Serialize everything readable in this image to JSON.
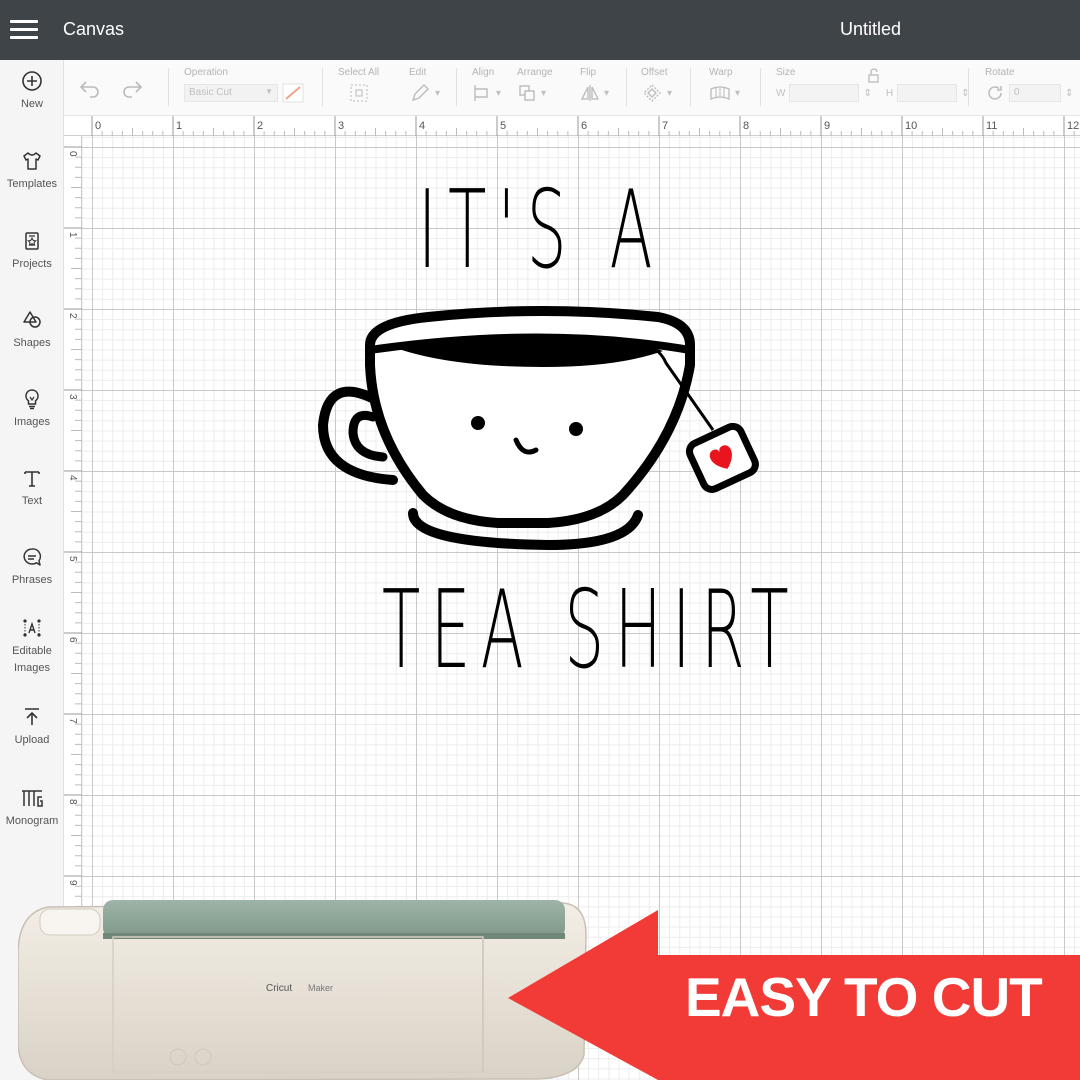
{
  "header": {
    "app_title": "Canvas",
    "doc_title": "Untitled"
  },
  "sidebar": {
    "items": [
      {
        "label": "New",
        "icon": "plus-circle-icon"
      },
      {
        "label": "Templates",
        "icon": "tshirt-icon"
      },
      {
        "label": "Projects",
        "icon": "projects-icon"
      },
      {
        "label": "Shapes",
        "icon": "shapes-icon"
      },
      {
        "label": "Images",
        "icon": "lightbulb-icon"
      },
      {
        "label": "Text",
        "icon": "text-icon"
      },
      {
        "label": "Phrases",
        "icon": "speech-bubble-icon"
      },
      {
        "label": "Editable Images",
        "icon": "editable-images-icon"
      },
      {
        "label": "Upload",
        "icon": "upload-icon"
      },
      {
        "label": "Monogram",
        "icon": "monogram-icon"
      }
    ]
  },
  "toolbar": {
    "operation_label": "Operation",
    "operation_value": "Basic Cut",
    "select_all_label": "Select All",
    "edit_label": "Edit",
    "align_label": "Align",
    "arrange_label": "Arrange",
    "flip_label": "Flip",
    "offset_label": "Offset",
    "warp_label": "Warp",
    "size_label": "Size",
    "size_w": "W",
    "size_h": "H",
    "rotate_label": "Rotate",
    "rotate_value": "0"
  },
  "ruler": {
    "h_ticks": [
      "0",
      "1",
      "2",
      "3",
      "4",
      "5",
      "6",
      "7",
      "8",
      "9",
      "10",
      "11",
      "12"
    ],
    "v_ticks": [
      "0",
      "1",
      "2",
      "3",
      "4",
      "5",
      "6",
      "7",
      "8",
      "9"
    ]
  },
  "design": {
    "line1": "IT'S A",
    "line2": "TEA SHIRT",
    "heart_color": "#e8141e"
  },
  "machine": {
    "brand": "Cricut",
    "model": "Maker",
    "lid_color": "#8fa89a",
    "body_color": "#ece6dc"
  },
  "callout": {
    "text": "EASY TO CUT",
    "color": "#f23a36"
  }
}
